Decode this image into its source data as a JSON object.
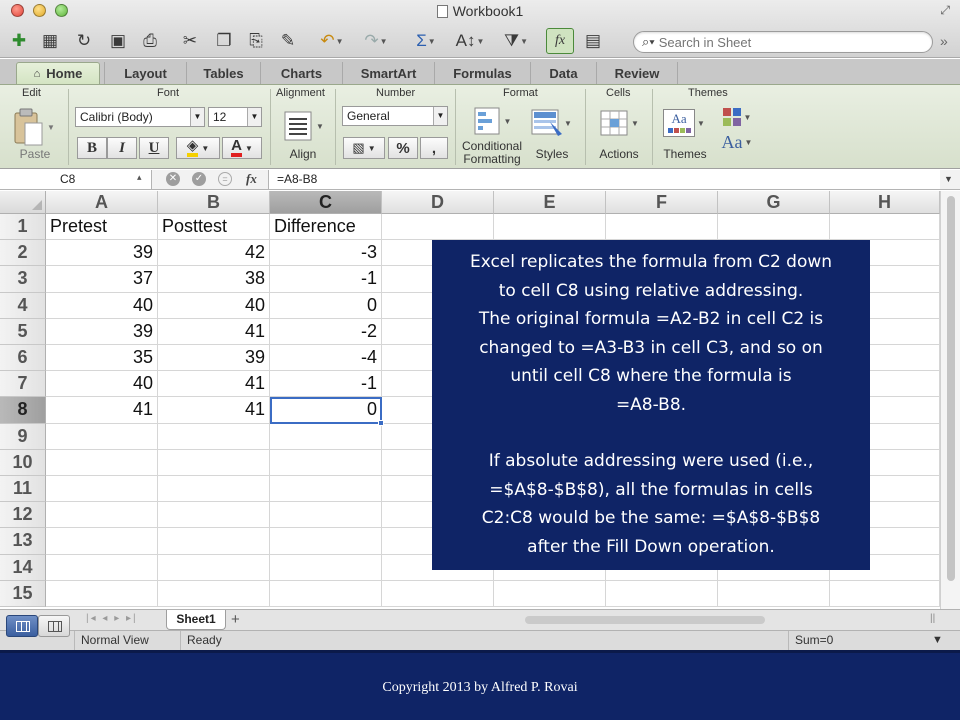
{
  "window": {
    "title": "Workbook1"
  },
  "toolbar": {
    "search_placeholder": "Search in Sheet",
    "icons": [
      "new-doc-icon",
      "templates-icon",
      "open-icon",
      "save-icon",
      "print-icon",
      "cut-icon",
      "copy-icon",
      "paste-icon",
      "format-painter-icon",
      "undo-icon",
      "redo-icon",
      "autosum-icon",
      "sort-icon",
      "filter-icon",
      "formula-builder-icon",
      "toolbox-icon",
      "search-icon"
    ]
  },
  "ribbon_tabs": [
    "Home",
    "Layout",
    "Tables",
    "Charts",
    "SmartArt",
    "Formulas",
    "Data",
    "Review"
  ],
  "ribbon": {
    "groups": {
      "edit": "Edit",
      "font": "Font",
      "alignment": "Alignment",
      "number": "Number",
      "format": "Format",
      "cells": "Cells",
      "themes": "Themes"
    },
    "paste_label": "Paste",
    "font_name": "Calibri (Body)",
    "font_size": "12",
    "bold": "B",
    "italic": "I",
    "underline": "U",
    "align_label": "Align",
    "number_format": "General",
    "percent": "%",
    "comma": ",",
    "conditional_line1": "Conditional",
    "conditional_line2": "Formatting",
    "styles_label": "Styles",
    "actions_label": "Actions",
    "themes_label": "Themes",
    "themes_aa": "Aa",
    "accent_colors": {
      "fill": "#f5d000",
      "font": "#e02020"
    }
  },
  "formula_bar": {
    "name_box": "C8",
    "fx": "fx",
    "formula": "=A8-B8"
  },
  "grid": {
    "columns": [
      "A",
      "B",
      "C",
      "D",
      "E",
      "F",
      "G",
      "H"
    ],
    "selected_column": "C",
    "selected_row": "8",
    "row_numbers": [
      "1",
      "2",
      "3",
      "4",
      "5",
      "6",
      "7",
      "8",
      "9",
      "10",
      "11",
      "12",
      "13",
      "14",
      "15"
    ],
    "rows": [
      [
        "Pretest",
        "Posttest",
        "Difference"
      ],
      [
        "39",
        "42",
        "-3"
      ],
      [
        "37",
        "38",
        "-1"
      ],
      [
        "40",
        "40",
        "0"
      ],
      [
        "39",
        "41",
        "-2"
      ],
      [
        "35",
        "39",
        "-4"
      ],
      [
        "40",
        "41",
        "-1"
      ],
      [
        "41",
        "41",
        "0"
      ]
    ]
  },
  "callout": {
    "para1_lines": [
      "Excel replicates the formula from C2 down",
      "to cell C8 using relative addressing.",
      "The original formula =A2-B2 in cell C2 is",
      "changed to =A3-B3 in cell C3, and so on",
      "until cell C8 where the formula is",
      "=A8-B8."
    ],
    "para2_lines": [
      "If absolute addressing were used  (i.e.,",
      "=$A$8-$B$8), all the formulas in cells",
      "C2:C8 would be the same: =$A$8-$B$8",
      "after the Fill Down operation."
    ]
  },
  "sheet_tabs": {
    "active": "Sheet1",
    "add": "+"
  },
  "status_bar": {
    "view": "Normal View",
    "state": "Ready",
    "sum": "Sum=0"
  },
  "footer": {
    "copyright": "Copyright 2013 by Alfred P. Rovai"
  },
  "colors": {
    "callout_bg": "#0f2466",
    "selection": "#3b6cc4",
    "ribbon_bg": "#e2eada"
  }
}
